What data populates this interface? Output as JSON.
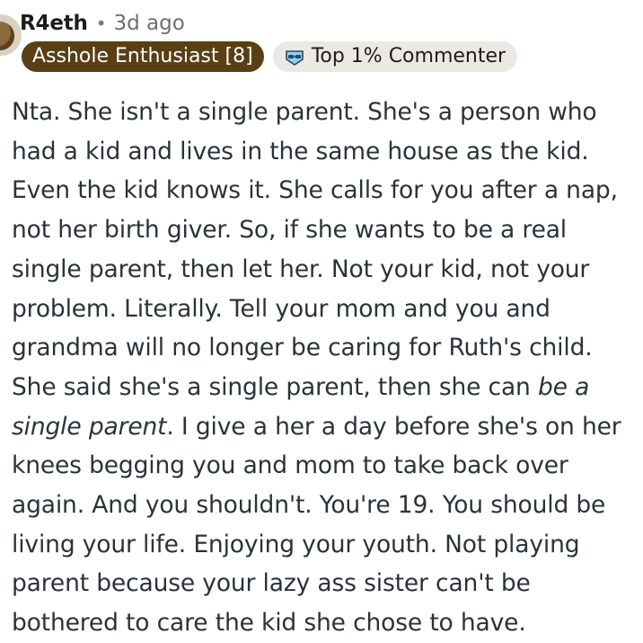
{
  "comment": {
    "username": "R4eth",
    "separator": "•",
    "timestamp": "3d ago",
    "flair_primary": "Asshole Enthusiast [8]",
    "flair_secondary": "Top 1% Commenter",
    "flair_secondary_icon": "commenter-badge-icon",
    "body": {
      "before_emphasis": "Nta. She isn't a single parent. She's a person who had a kid and lives in the same house as the kid. Even the kid knows it. She calls for you after a nap, not her birth giver. So, if she wants to be a real single parent, then let her. Not your kid, not your problem. Literally. Tell your mom and you and grandma will no longer be caring for Ruth's child. She said she's a single parent, then she can ",
      "emphasis": "be a single parent",
      "after_emphasis": ". I give a her a day before she's on her knees begging you and mom to take back over again. And you shouldn't. You're 19. You should be living your life. Enjoying your youth. Not playing parent because your lazy ass sister can't be bothered to care the kid she chose to have."
    }
  },
  "colors": {
    "flair_primary_bg": "#5a3f14",
    "flair_secondary_bg": "#ece9e4",
    "body_text": "#2a3338"
  }
}
